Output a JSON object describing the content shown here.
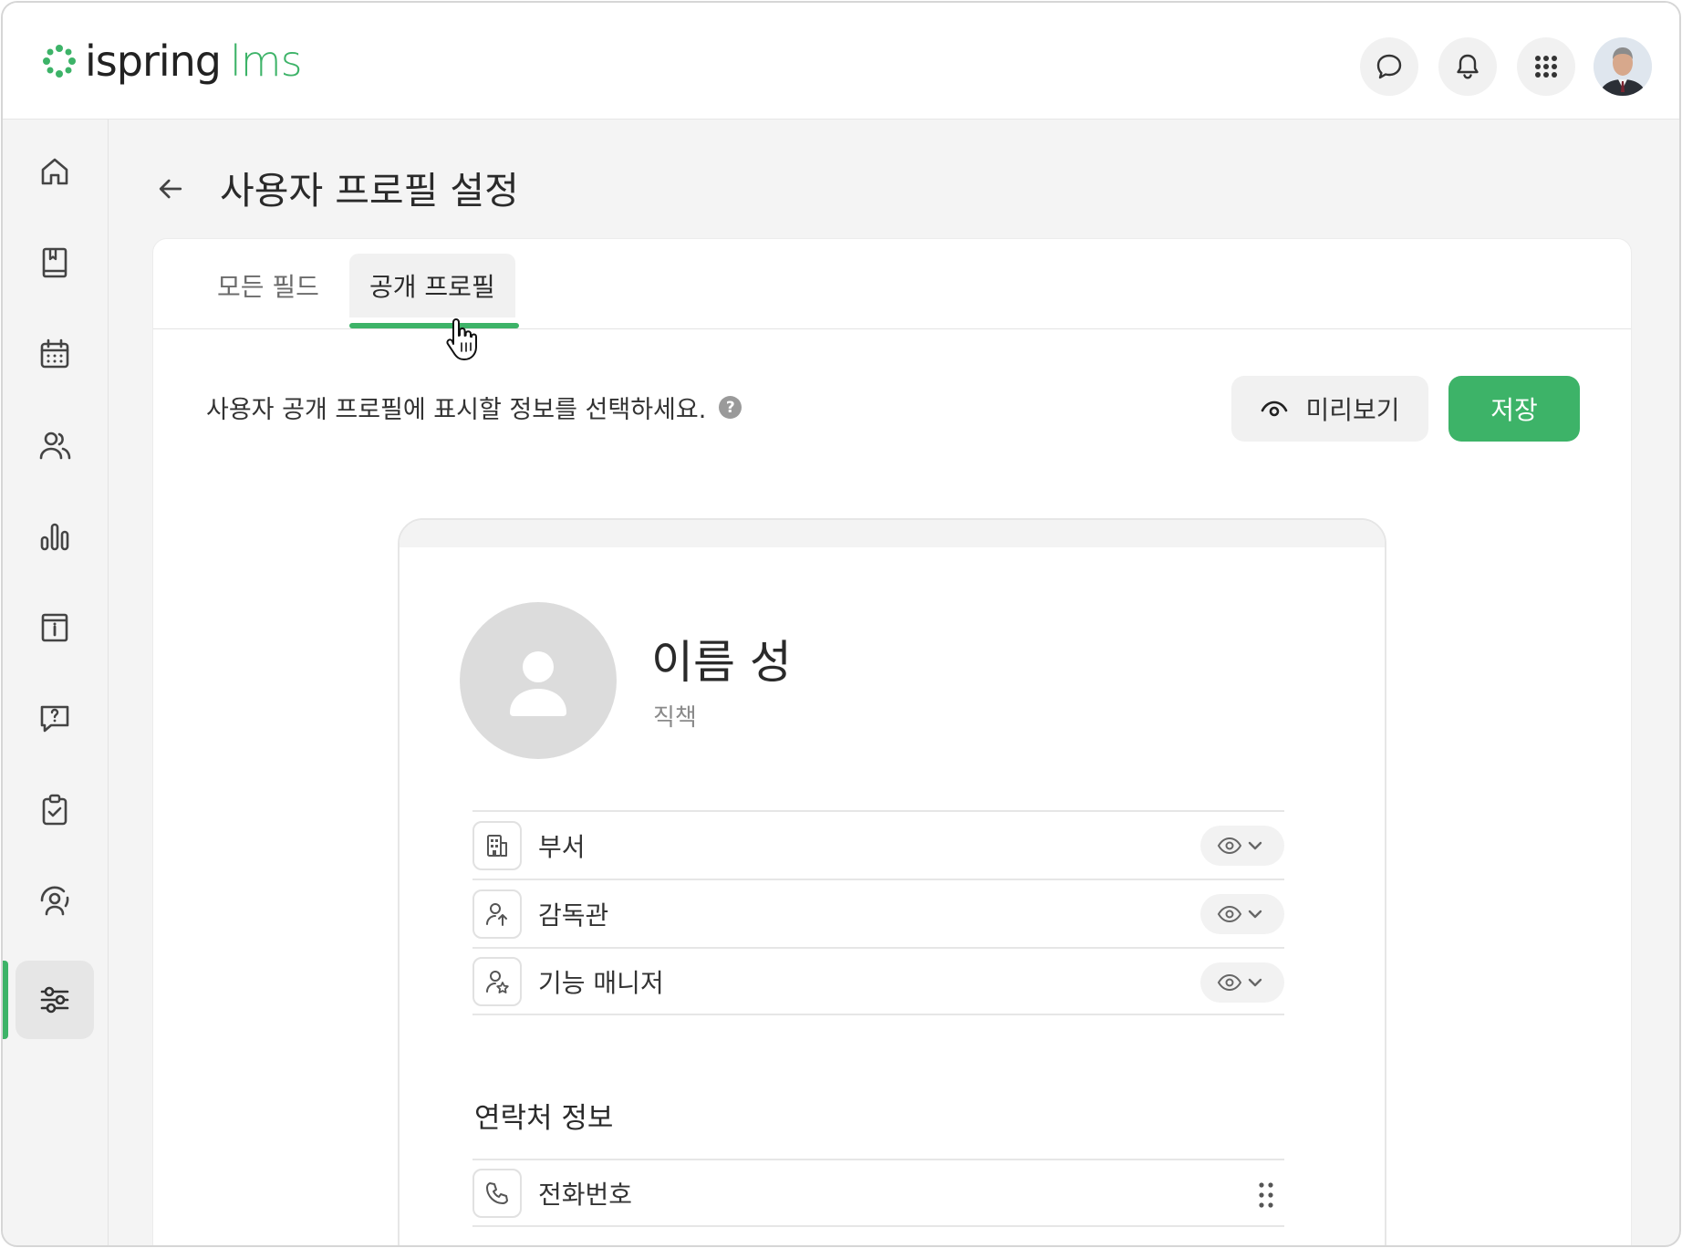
{
  "header": {
    "brand": "ispring",
    "brand_accent": "lms",
    "icons": [
      "chat-icon",
      "bell-icon",
      "apps-grid-icon"
    ],
    "avatar": "user-avatar"
  },
  "sidebar": {
    "items": [
      {
        "icon": "home-icon"
      },
      {
        "icon": "book-icon"
      },
      {
        "icon": "calendar-icon"
      },
      {
        "icon": "users-icon"
      },
      {
        "icon": "bar-chart-icon"
      },
      {
        "icon": "info-archive-icon"
      },
      {
        "icon": "question-chat-icon"
      },
      {
        "icon": "clipboard-check-icon"
      },
      {
        "icon": "user-cycle-icon"
      },
      {
        "icon": "sliders-icon",
        "active": true
      }
    ],
    "accent_color": "#3db368"
  },
  "page": {
    "title": "사용자 프로필 설정"
  },
  "tabs": [
    {
      "label": "모든 필드",
      "active": false
    },
    {
      "label": "공개 프로필",
      "active": true
    }
  ],
  "toolbar": {
    "description": "사용자 공개 프로필에 표시할 정보를 선택하세요.",
    "help": "?",
    "preview_label": "미리보기",
    "save_label": "저장"
  },
  "profile": {
    "name": "이름 성",
    "job_title": "직책"
  },
  "fields": [
    {
      "label": "부서",
      "icon": "building-icon"
    },
    {
      "label": "감독관",
      "icon": "supervisor-icon"
    },
    {
      "label": "기능 매니저",
      "icon": "manager-star-icon"
    }
  ],
  "contact_section": {
    "title": "연락처 정보",
    "fields": [
      {
        "label": "전화번호",
        "icon": "phone-icon"
      }
    ]
  }
}
